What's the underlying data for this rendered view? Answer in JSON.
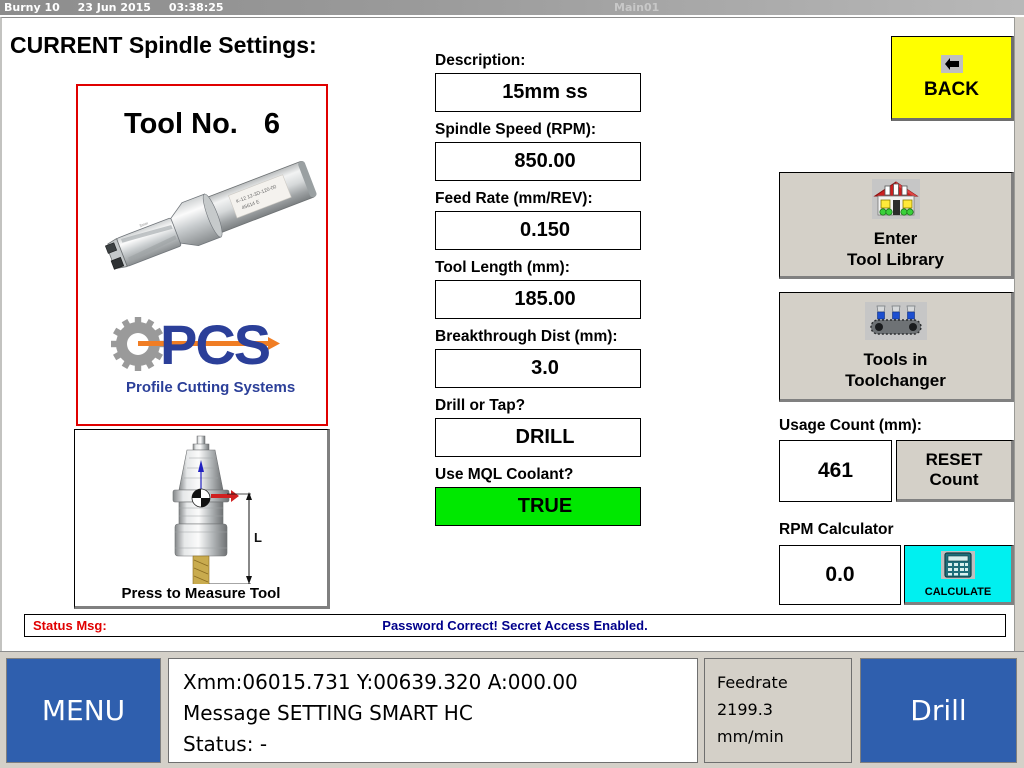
{
  "titlebar": {
    "app": "Burny 10",
    "date": "23 Jun 2015",
    "time": "03:38:25",
    "window_title": "Main01"
  },
  "page": {
    "heading": "CURRENT Spindle Settings:"
  },
  "tool_panel": {
    "tool_no_label": "Tool No.",
    "tool_no_value": "6",
    "drill_image_name": "indexable-insert-drill-photo",
    "logo_text": "PCS",
    "logo_tagline": "Profile Cutting Systems",
    "logo_colors": {
      "blue": "#2b3f99",
      "orange": "#f07d24",
      "gear_gray": "#9a9a9a"
    }
  },
  "measure_panel": {
    "holder_image_name": "bt-toolholder-diagram",
    "dimension_label": "L",
    "caption": "Press to Measure Tool"
  },
  "fields": [
    {
      "label": "Description:",
      "value": "15mm ss",
      "name": "description"
    },
    {
      "label": "Spindle Speed (RPM):",
      "value": "850.00",
      "name": "spindle-speed"
    },
    {
      "label": "Feed Rate (mm/REV):",
      "value": "0.150",
      "name": "feed-rate"
    },
    {
      "label": "Tool Length (mm):",
      "value": "185.00",
      "name": "tool-length"
    },
    {
      "label": "Breakthrough Dist (mm):",
      "value": "3.0",
      "name": "breakthrough-dist"
    },
    {
      "label": "Drill or Tap?",
      "value": "DRILL",
      "name": "drill-or-tap"
    },
    {
      "label": "Use MQL Coolant?",
      "value": "TRUE",
      "name": "mql-coolant",
      "highlight": "#00e800"
    }
  ],
  "right_panel": {
    "back_label": "BACK",
    "back_color": "#ffff00",
    "tool_library_line1": "Enter",
    "tool_library_line2": "Tool Library",
    "toolchanger_line1": "Tools in",
    "toolchanger_line2": "Toolchanger",
    "usage_label": "Usage Count (mm):",
    "usage_value": "461",
    "reset_line1": "RESET",
    "reset_line2": "Count",
    "rpm_label": "RPM Calculator",
    "rpm_value": "0.0",
    "calculate_label": "CALCULATE",
    "calculate_color": "#00f0f0"
  },
  "status": {
    "key": "Status Msg:",
    "message": "Password Correct! Secret Access Enabled.",
    "key_color": "#e00000",
    "message_color": "#00008b"
  },
  "bottom_bar": {
    "menu_label": "MENU",
    "readout_line1": "Xmm:06015.731 Y:00639.320 A:000.00",
    "readout_line2": "Message SETTING SMART HC",
    "readout_line3": "Status:  -",
    "feed_line1": "Feedrate",
    "feed_line2": "2199.3",
    "feed_line3": "mm/min",
    "drill_label": "Drill",
    "button_color": "#2f5fae"
  }
}
